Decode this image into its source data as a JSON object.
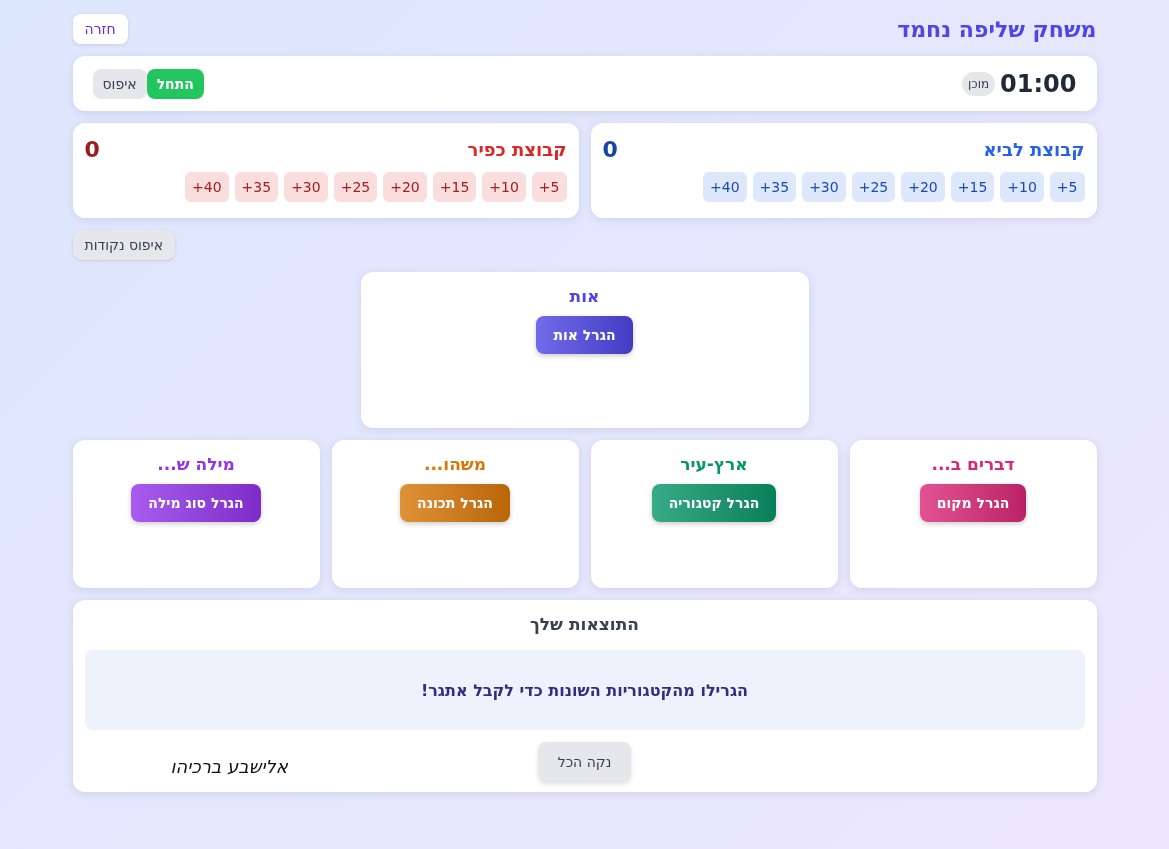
{
  "header": {
    "title": "משחק שליפה נחמד",
    "back_button": "חזרה"
  },
  "timer": {
    "time": "01:00",
    "status": "מוכן",
    "start_button": "התחל",
    "reset_button": "איפוס"
  },
  "teams": [
    {
      "name": "קבוצת לביא",
      "score": "0",
      "color": "#2563eb",
      "points": [
        "+5",
        "+10",
        "+15",
        "+20",
        "+25",
        "+30",
        "+35",
        "+40"
      ]
    },
    {
      "name": "קבוצת כפיר",
      "score": "0",
      "color": "#dc2626",
      "points": [
        "+5",
        "+10",
        "+15",
        "+20",
        "+25",
        "+30",
        "+35",
        "+40"
      ]
    }
  ],
  "reset_points_button": "איפוס נקודות",
  "letter_card": {
    "title": "אות",
    "button": "הגרל אות",
    "color": "#4f46e5"
  },
  "category_cards": [
    {
      "title": "דברים ב...",
      "button": "הגרל מקום",
      "color": "#db2777"
    },
    {
      "title": "ארץ-עיר",
      "button": "הגרל קטגוריה",
      "color": "#059669"
    },
    {
      "title": "משהו...",
      "button": "הגרל תכונה",
      "color": "#d97706"
    },
    {
      "title": "מילה ש...",
      "button": "הגרל סוג מילה",
      "color": "#9333ea"
    }
  ],
  "results": {
    "title": "התוצאות שלך",
    "message": "הגרילו מהקטגוריות השונות כדי לקבל אתגר!",
    "clear_button": "נקה הכל",
    "signature": "אלישבע ברכיהו"
  }
}
